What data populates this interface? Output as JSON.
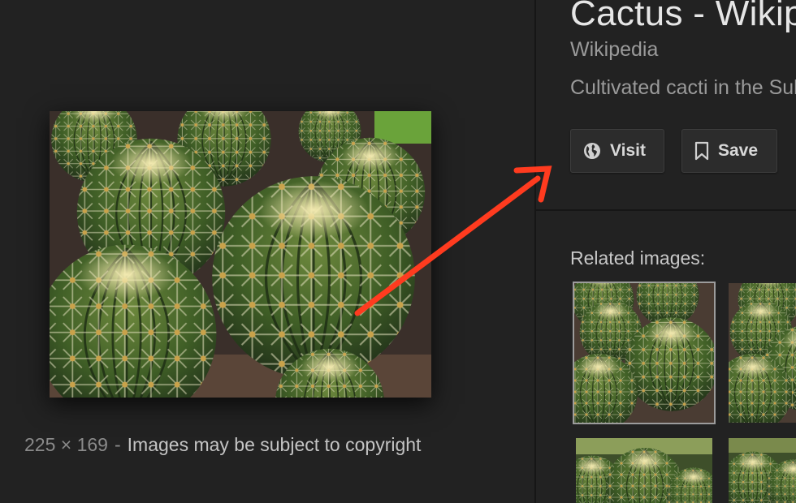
{
  "main_image": {
    "alt": "Golden barrel cacti",
    "dimensions": "225 × 169",
    "separator": "-",
    "copyright_notice": "Images may be subject to copyright"
  },
  "result": {
    "title": "Cactus - Wikipedia",
    "source": "Wikipedia",
    "description": "Cultivated cacti in the Sukkulenten-Sammlung Zürich"
  },
  "actions": {
    "visit_label": "Visit",
    "save_label": "Save"
  },
  "related": {
    "label": "Related images:"
  },
  "colors": {
    "background": "#222222",
    "annotation_arrow": "#ff3b1f",
    "selected_outline": "#9c9c9c"
  },
  "icons": [
    "globe-icon",
    "bookmark-icon"
  ]
}
